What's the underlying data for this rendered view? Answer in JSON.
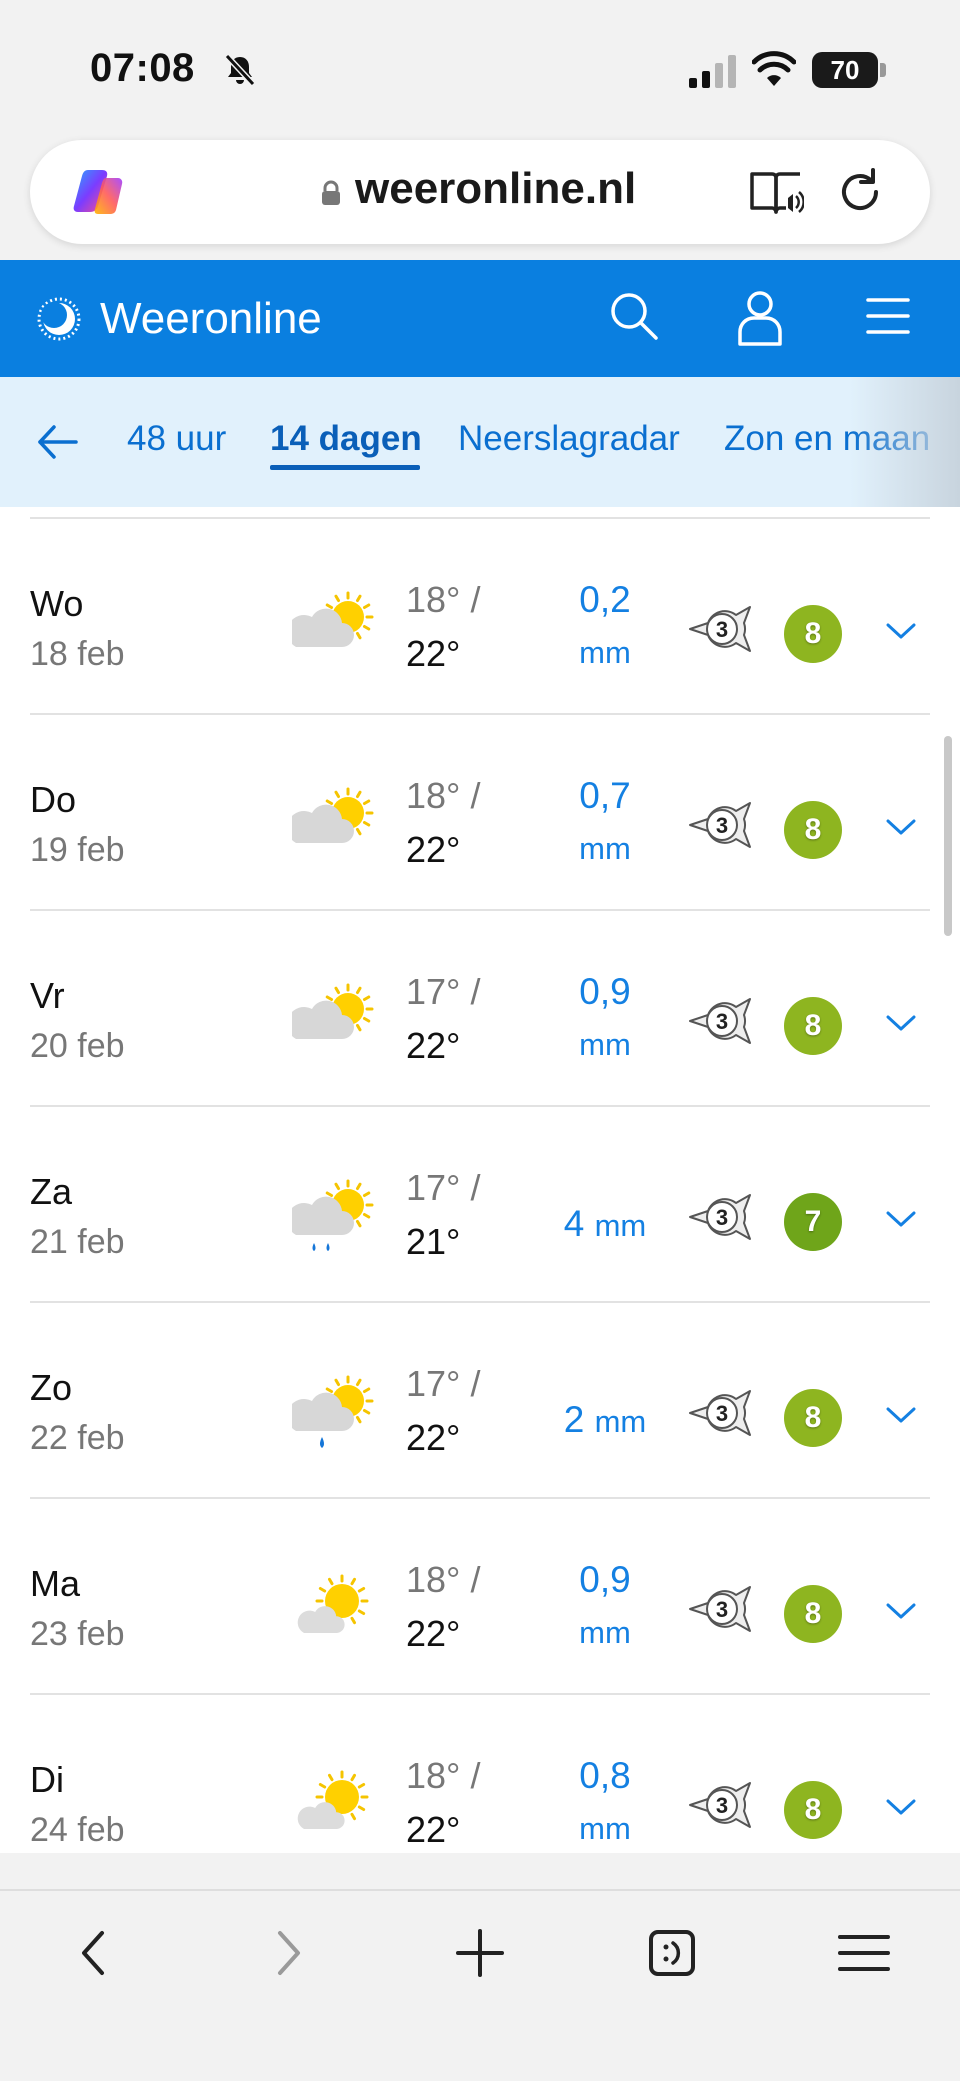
{
  "status_bar": {
    "time": "07:08",
    "battery": "70"
  },
  "address_bar": {
    "url": "weeronline.nl"
  },
  "site_header": {
    "logo_text": "Weeronline"
  },
  "tabs": [
    {
      "label": "48 uur",
      "active": false
    },
    {
      "label": "14 dagen",
      "active": true
    },
    {
      "label": "Neerslagradar",
      "active": false
    },
    {
      "label": "Zon en maan",
      "active": false
    }
  ],
  "forecast": [
    {
      "day": "Wo",
      "date": "18 feb",
      "icon": "partly-cloudy-icon",
      "temp_low": "18° /",
      "temp_high": "22°",
      "rain_value": "0,2",
      "rain_unit": "mm",
      "rain_layout": "stacked",
      "wind_force": "3",
      "score": "8",
      "score_color": "#8eb520"
    },
    {
      "day": "Do",
      "date": "19 feb",
      "icon": "partly-cloudy-icon",
      "temp_low": "18° /",
      "temp_high": "22°",
      "rain_value": "0,7",
      "rain_unit": "mm",
      "rain_layout": "stacked",
      "wind_force": "3",
      "score": "8",
      "score_color": "#8eb520"
    },
    {
      "day": "Vr",
      "date": "20 feb",
      "icon": "partly-cloudy-icon",
      "temp_low": "17° /",
      "temp_high": "22°",
      "rain_value": "0,9",
      "rain_unit": "mm",
      "rain_layout": "stacked",
      "wind_force": "3",
      "score": "8",
      "score_color": "#8eb520"
    },
    {
      "day": "Za",
      "date": "21 feb",
      "icon": "sun-cloud-rain-icon",
      "temp_low": "17° /",
      "temp_high": "21°",
      "rain_value": "4",
      "rain_unit": "mm",
      "rain_layout": "inline",
      "wind_force": "3",
      "score": "7",
      "score_color": "#6fa51a"
    },
    {
      "day": "Zo",
      "date": "22 feb",
      "icon": "sun-cloud-drizzle-icon",
      "temp_low": "17° /",
      "temp_high": "22°",
      "rain_value": "2",
      "rain_unit": "mm",
      "rain_layout": "inline",
      "wind_force": "3",
      "score": "8",
      "score_color": "#8eb520"
    },
    {
      "day": "Ma",
      "date": "23 feb",
      "icon": "mostly-sunny-icon",
      "temp_low": "18° /",
      "temp_high": "22°",
      "rain_value": "0,9",
      "rain_unit": "mm",
      "rain_layout": "stacked",
      "wind_force": "3",
      "score": "8",
      "score_color": "#8eb520"
    },
    {
      "day": "Di",
      "date": "24 feb",
      "icon": "mostly-sunny-icon",
      "temp_low": "18° /",
      "temp_high": "22°",
      "rain_value": "0,8",
      "rain_unit": "mm",
      "rain_layout": "stacked",
      "wind_force": "3",
      "score": "8",
      "score_color": "#8eb520"
    }
  ],
  "colors": {
    "brand_blue": "#0a7fe0",
    "tab_bg": "#e1f1fc",
    "rain_blue": "#1480e2"
  },
  "toolbar_icons": [
    "back-icon",
    "forward-icon",
    "new-tab-icon",
    "tabs-icon",
    "menu-icon"
  ]
}
